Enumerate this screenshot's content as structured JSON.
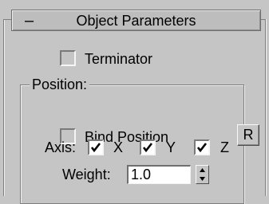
{
  "rollout": {
    "toggle_symbol": "–",
    "title": "Object Parameters"
  },
  "terminator": {
    "label": "Terminator",
    "checked": false
  },
  "position_group": {
    "title": "Position:",
    "bind_position": {
      "label": "Bind Position",
      "checked": false
    },
    "reset_button_label": "R",
    "axis": {
      "label": "Axis:",
      "x": {
        "label": "X",
        "checked": true
      },
      "y": {
        "label": "Y",
        "checked": true
      },
      "z": {
        "label": "Z",
        "checked": true
      }
    },
    "weight": {
      "label": "Weight:",
      "value": "1.0"
    }
  },
  "icons": {
    "check": "check-mark-icon",
    "spinner_up": "triangle-up-icon",
    "spinner_down": "triangle-down-icon"
  }
}
